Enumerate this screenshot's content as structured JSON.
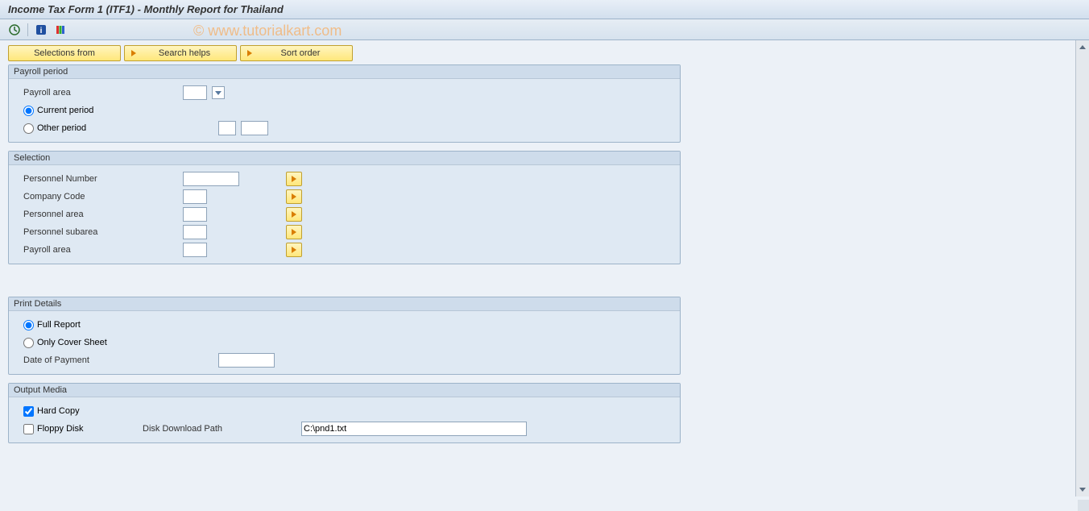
{
  "title": "Income Tax Form 1 (ITF1) - Monthly Report for Thailand",
  "watermark": "© www.tutorialkart.com",
  "buttons": {
    "selections_from": "Selections from",
    "search_helps": "Search helps",
    "sort_order": "Sort order"
  },
  "payroll_period": {
    "title": "Payroll period",
    "payroll_area_label": "Payroll area",
    "current_period_label": "Current period",
    "other_period_label": "Other period",
    "current_selected": true,
    "other_selected": false,
    "area_value": "",
    "p1_value": "",
    "p2_value": ""
  },
  "selection": {
    "title": "Selection",
    "fields": [
      {
        "label": "Personnel Number",
        "value": "",
        "width": "input-md"
      },
      {
        "label": "Company Code",
        "value": "",
        "width": "input-sm"
      },
      {
        "label": "Personnel area",
        "value": "",
        "width": "input-sm"
      },
      {
        "label": "Personnel subarea",
        "value": "",
        "width": "input-sm"
      },
      {
        "label": "Payroll area",
        "value": "",
        "width": "input-sm"
      }
    ]
  },
  "print_details": {
    "title": "Print Details",
    "full_report_label": "Full Report",
    "cover_sheet_label": "Only Cover Sheet",
    "date_payment_label": "Date of Payment",
    "full_selected": true,
    "cover_selected": false,
    "date_value": ""
  },
  "output_media": {
    "title": "Output Media",
    "hard_copy_label": "Hard Copy",
    "floppy_label": "Floppy Disk",
    "path_label": "Disk Download Path",
    "hard_checked": true,
    "floppy_checked": false,
    "path_value": "C:\\pnd1.txt"
  }
}
